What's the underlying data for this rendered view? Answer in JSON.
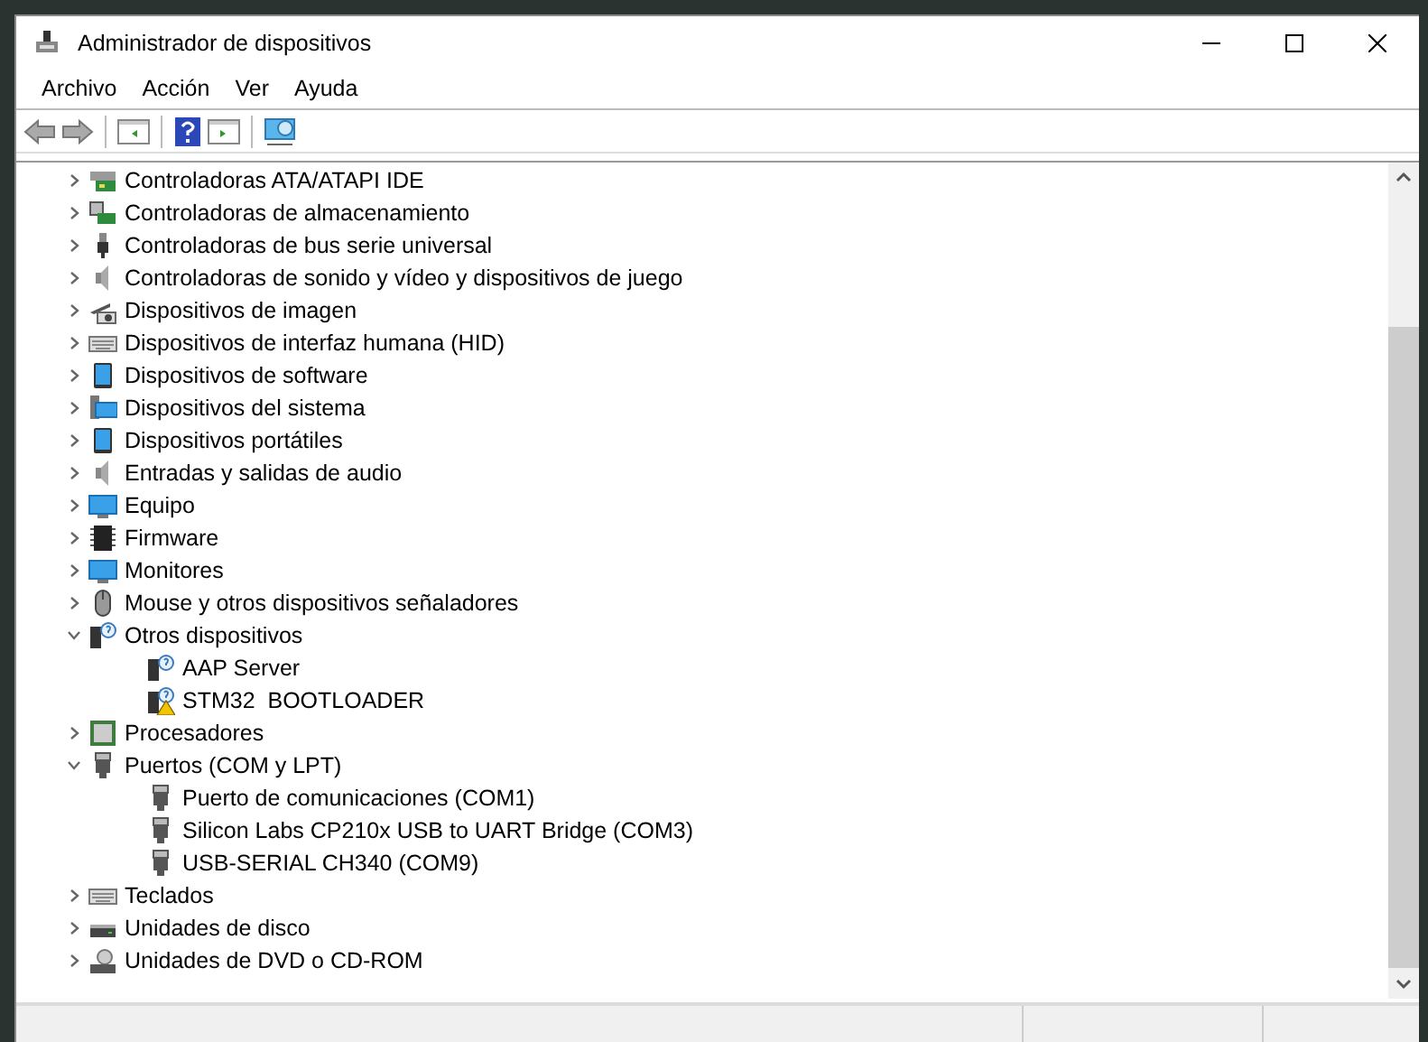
{
  "window": {
    "title": "Administrador de dispositivos"
  },
  "menu": [
    "Archivo",
    "Acción",
    "Ver",
    "Ayuda"
  ],
  "tree": [
    {
      "label": "Controladoras ATA/ATAPI IDE",
      "expanded": false
    },
    {
      "label": "Controladoras de almacenamiento",
      "expanded": false
    },
    {
      "label": "Controladoras de bus serie universal",
      "expanded": false
    },
    {
      "label": "Controladoras de sonido y vídeo y dispositivos de juego",
      "expanded": false
    },
    {
      "label": "Dispositivos de imagen",
      "expanded": false
    },
    {
      "label": "Dispositivos de interfaz humana (HID)",
      "expanded": false
    },
    {
      "label": "Dispositivos de software",
      "expanded": false
    },
    {
      "label": "Dispositivos del sistema",
      "expanded": false
    },
    {
      "label": "Dispositivos portátiles",
      "expanded": false
    },
    {
      "label": "Entradas y salidas de audio",
      "expanded": false
    },
    {
      "label": "Equipo",
      "expanded": false
    },
    {
      "label": "Firmware",
      "expanded": false
    },
    {
      "label": "Monitores",
      "expanded": false
    },
    {
      "label": "Mouse y otros dispositivos señaladores",
      "expanded": false
    },
    {
      "label": "Otros dispositivos",
      "expanded": true,
      "children": [
        {
          "label": "AAP Server",
          "warning": false
        },
        {
          "label": "STM32  BOOTLOADER",
          "warning": true
        }
      ]
    },
    {
      "label": "Procesadores",
      "expanded": false
    },
    {
      "label": "Puertos (COM y LPT)",
      "expanded": true,
      "children": [
        {
          "label": "Puerto de comunicaciones (COM1)",
          "warning": false
        },
        {
          "label": "Silicon Labs CP210x USB to UART Bridge (COM3)",
          "warning": false
        },
        {
          "label": "USB-SERIAL CH340 (COM9)",
          "warning": false
        }
      ]
    },
    {
      "label": "Teclados",
      "expanded": false
    },
    {
      "label": "Unidades de disco",
      "expanded": false
    },
    {
      "label": "Unidades de DVD o CD-ROM",
      "expanded": false
    }
  ]
}
